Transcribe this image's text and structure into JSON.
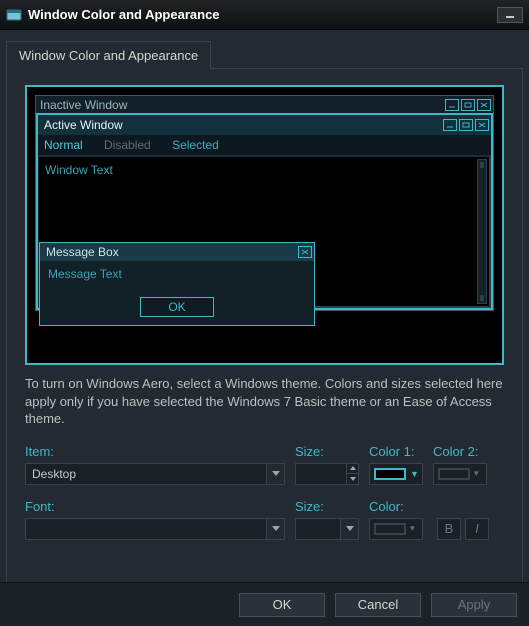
{
  "title": "Window Color and Appearance",
  "tab_label": "Window Color and Appearance",
  "preview": {
    "inactive_title": "Inactive Window",
    "active_title": "Active Window",
    "menu": {
      "normal": "Normal",
      "disabled": "Disabled",
      "selected": "Selected"
    },
    "window_text": "Window Text",
    "msgbox_title": "Message Box",
    "msgbox_text": "Message Text",
    "msgbox_ok": "OK"
  },
  "description": "To turn on Windows Aero, select a Windows theme.  Colors and sizes selected here apply only if you have selected the Windows 7 Basic theme or an Ease of Access theme.",
  "form": {
    "item_label": "Item:",
    "item_value": "Desktop",
    "size_label": "Size:",
    "color1_label": "Color 1:",
    "color2_label": "Color 2:",
    "font_label": "Font:",
    "font_size_label": "Size:",
    "font_color_label": "Color:",
    "bold": "B",
    "italic": "I"
  },
  "actions": {
    "ok": "OK",
    "cancel": "Cancel",
    "apply": "Apply"
  },
  "colors": {
    "accent": "#3fb8c9",
    "panel": "#232a31",
    "border": "#3a434c"
  }
}
